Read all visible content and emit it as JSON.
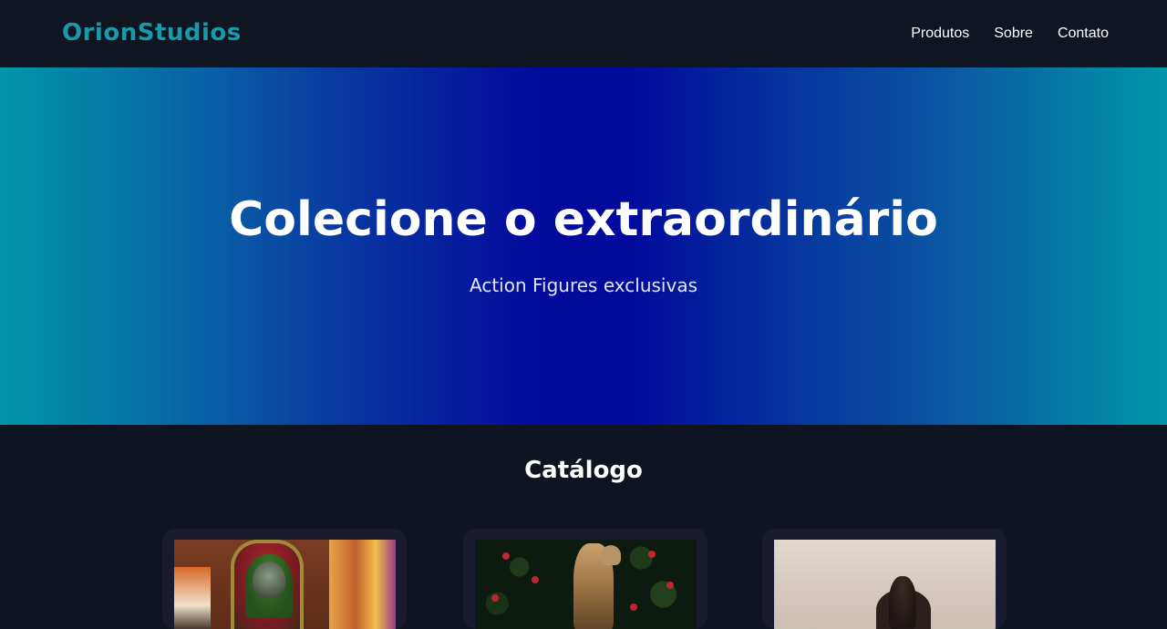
{
  "header": {
    "brand": "OrionStudios",
    "nav": [
      "Produtos",
      "Sobre",
      "Contato"
    ]
  },
  "hero": {
    "title": "Colecione o extraordinário",
    "subtitle": "Action Figures exclusivas"
  },
  "catalog": {
    "title": "Catálogo",
    "cards": [
      {
        "image": "product-photo"
      },
      {
        "image": "product-photo"
      },
      {
        "image": "product-photo"
      }
    ]
  },
  "colors": {
    "brand": "#1a9aa8",
    "header_bg": "#101522",
    "page_bg": "#0f1422",
    "card_bg": "#1a1b2e",
    "hero_edge": "#0096a8",
    "hero_center": "#020a9c"
  }
}
